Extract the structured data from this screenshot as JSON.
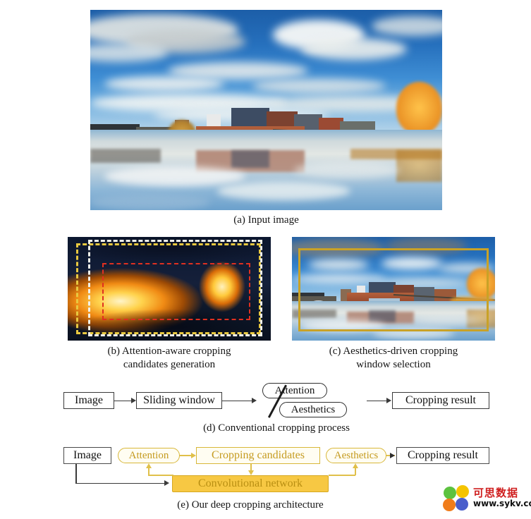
{
  "figure": {
    "panels": [
      {
        "id": "a",
        "caption": "(a) Input image",
        "description": "Panoramic photo of a riverside town with blue sky, clouds, stone bridge, brick buildings and mirror reflections in the water"
      },
      {
        "id": "b",
        "caption_line1": "(b) Attention-aware cropping",
        "caption_line2": "candidates generation",
        "description": "Attention heat map of the input image with three dashed candidate cropping rectangles",
        "candidate_boxes": [
          {
            "name": "yellow-candidate",
            "color": "#e8c840",
            "style": "dashed"
          },
          {
            "name": "white-candidate",
            "color": "#f2f2ea",
            "style": "dashed"
          },
          {
            "name": "red-candidate",
            "color": "#e03020",
            "style": "dashed"
          }
        ]
      },
      {
        "id": "c",
        "caption_line1": "(c) Aesthetics-driven cropping",
        "caption_line2": "window selection",
        "description": "The input image with a single solid gold cropping window selected",
        "selection_color": "#c9a227"
      }
    ]
  },
  "diagram_d": {
    "caption": "(d) Conventional cropping process",
    "nodes": [
      {
        "key": "image",
        "label": "Image",
        "shape": "rect"
      },
      {
        "key": "sliding",
        "label": "Sliding window",
        "shape": "rect"
      },
      {
        "key": "attention",
        "label": "Attention",
        "shape": "pill"
      },
      {
        "key": "aesthetics",
        "label": "Aesthetics",
        "shape": "pill"
      },
      {
        "key": "result",
        "label": "Cropping result",
        "shape": "rect"
      }
    ]
  },
  "diagram_e": {
    "caption": "(e) Our deep cropping architecture",
    "nodes": [
      {
        "key": "image",
        "label": "Image",
        "shape": "rect",
        "color": "#111111"
      },
      {
        "key": "attention",
        "label": "Attention",
        "shape": "pill",
        "color": "#c59b20"
      },
      {
        "key": "candidates",
        "label": "Cropping candidates",
        "shape": "rect",
        "color": "#c59b20"
      },
      {
        "key": "aesthetics",
        "label": "Aesthetics",
        "shape": "pill",
        "color": "#c59b20"
      },
      {
        "key": "result",
        "label": "Cropping result",
        "shape": "rect",
        "color": "#111111"
      },
      {
        "key": "convnet",
        "label": "Convolutional network",
        "shape": "filled",
        "color": "#b98f12"
      }
    ],
    "accent_color": "#f7c843"
  },
  "watermark": {
    "text_cn": "可思数据",
    "url": "www.sykv.com",
    "petal_colors": [
      "#5cc23f",
      "#f5c400",
      "#f07c1a",
      "#4a5ecb"
    ]
  }
}
